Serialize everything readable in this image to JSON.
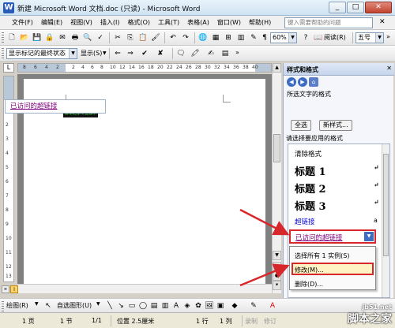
{
  "window": {
    "title": "新建 Microsoft Word 文档.doc (只读) - Microsoft Word",
    "app_icon": "W",
    "controls": [
      "_",
      "□",
      "✕"
    ]
  },
  "menu": {
    "items": [
      "文件(F)",
      "编辑(E)",
      "视图(V)",
      "插入(I)",
      "格式(O)",
      "工具(T)",
      "表格(A)",
      "窗口(W)",
      "帮助(H)"
    ],
    "help_placeholder": "键入需要帮助的问题",
    "close_glyph": "✕"
  },
  "toolbar1": {
    "zoom": "60%",
    "read_label": "阅读(R)",
    "font_size": "五号",
    "font_size_short": "5"
  },
  "toolbar2": {
    "markup_view": "显示标记的最终状态",
    "show_label": "显示(S)"
  },
  "ruler": {
    "left_tab": "L",
    "top_numbers": [
      "8",
      "6",
      "4",
      "2",
      "2",
      "4",
      "6",
      "8",
      "10",
      "12",
      "14",
      "16",
      "18",
      "20",
      "22",
      "24",
      "26",
      "28",
      "30",
      "32",
      "34",
      "36",
      "38",
      "40"
    ],
    "side_numbers": [
      "1",
      "2",
      "3",
      "4",
      "5",
      "6",
      "7",
      "8",
      "9",
      "10",
      "11",
      "12",
      "13",
      "14"
    ]
  },
  "document": {
    "selected_text": "脚本之家专业技术"
  },
  "drawing_toolbar": {
    "draw_label": "绘图(R)",
    "autoshapes_label": "自选图形(U)"
  },
  "status_bar": {
    "page": "1 页",
    "section": "1 节",
    "page_of": "1/1",
    "position": "位置 2.5厘米",
    "line": "1 行",
    "column": "1 列",
    "rec": "录制",
    "trk": "修订"
  },
  "task_pane": {
    "title": "样式和格式",
    "close_glyph": "✕",
    "selected_text_label": "所选文字的格式",
    "current_style": "已访问的超链接",
    "select_all_button": "全选",
    "new_style_button": "新样式...",
    "apply_label": "请选择要应用的格式",
    "styles": {
      "clear": "清除格式",
      "heading1": "标题 1",
      "heading2": "标题 2",
      "heading3": "标题 3",
      "hyperlink": "超链接",
      "paragraph_mark": "↵",
      "char_mark": "a"
    },
    "highlighted_style": "已访问的超链接"
  },
  "context_menu": {
    "select_all_instances": "选择所有 1 实例(S)",
    "modify": "修改(M)...",
    "delete": "删除(D)..."
  },
  "watermark": {
    "url": "jb51.net",
    "name": "脚本之家"
  },
  "colors": {
    "callout_red": "#d8272b",
    "visited_link": "#800080",
    "hyperlink": "#0000cc"
  }
}
